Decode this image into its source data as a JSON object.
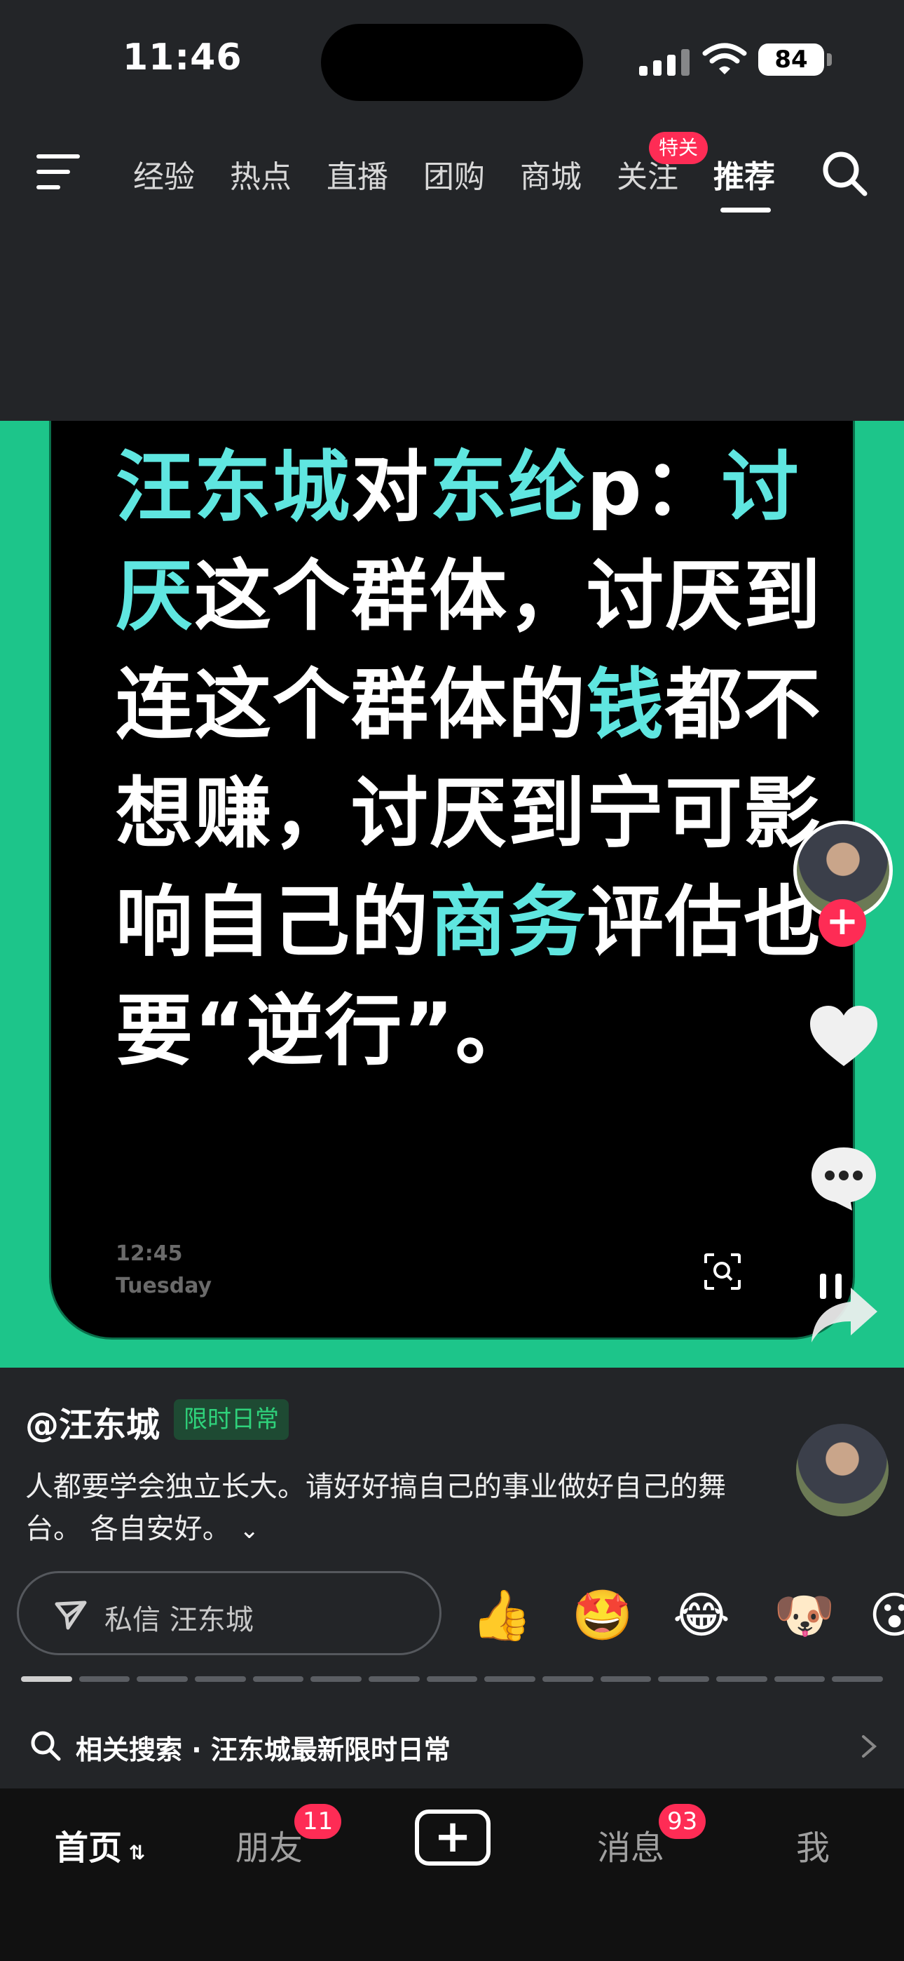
{
  "status_bar": {
    "time": "11:46",
    "battery": "84"
  },
  "top_nav": {
    "tabs": [
      "经验",
      "热点",
      "直播",
      "团购",
      "商城",
      "关注",
      "推荐"
    ],
    "active_tab": "推荐",
    "follow_badge": "特关"
  },
  "video": {
    "quote_segments": [
      {
        "text": "汪东城",
        "highlight": true
      },
      {
        "text": "对",
        "highlight": false
      },
      {
        "text": "东纶",
        "highlight": true
      },
      {
        "text": "p：",
        "highlight": false
      },
      {
        "text": "讨厌",
        "highlight": true
      },
      {
        "text": "这个群体，讨厌到连这个群体的",
        "highlight": false
      },
      {
        "text": "钱",
        "highlight": true
      },
      {
        "text": "都不想赚，讨厌到宁可影响自己的",
        "highlight": false
      },
      {
        "text": "商务",
        "highlight": true
      },
      {
        "text": "评估也要“逆行”。",
        "highlight": false
      }
    ],
    "shot_time": "12:45",
    "shot_day": "Tuesday"
  },
  "post": {
    "author": "@汪东城",
    "tag": "限时日常",
    "caption": "人都要学会独立长大。请好好搞自己的事业做好自己的舞台。 各自安好。",
    "dm_placeholder": "私信 汪东城",
    "emojis": [
      "👍",
      "🤩",
      "😂",
      "🐶",
      "😮"
    ],
    "progress_segments": 15,
    "progress_done": 1
  },
  "related_search": {
    "text": "相关搜索 · 汪东城最新限时日常"
  },
  "tab_bar": {
    "home": "首页",
    "friends": "朋友",
    "friends_badge": "11",
    "create": "+",
    "messages": "消息",
    "messages_badge": "93",
    "me": "我"
  }
}
